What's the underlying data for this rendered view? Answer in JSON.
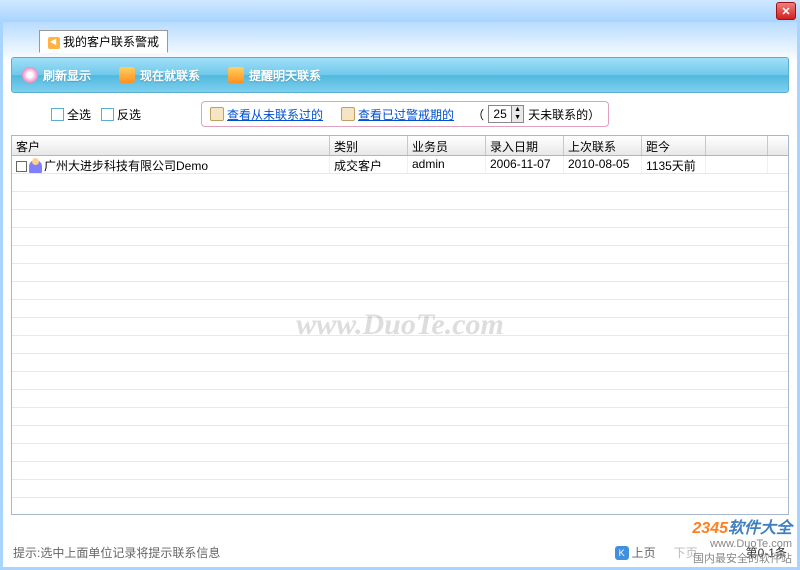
{
  "tab": {
    "label": "我的客户联系警戒"
  },
  "toolbar": {
    "refresh": "刷新显示",
    "contact_now": "现在就联系",
    "remind_tomorrow": "提醒明天联系"
  },
  "filters": {
    "select_all": "全选",
    "invert": "反选",
    "view_never": "查看从未联系过的",
    "view_expired": "查看已过警戒期的",
    "days_value": "25",
    "days_suffix": "天未联系的）",
    "days_prefix": "（"
  },
  "grid": {
    "headers": {
      "customer": "客户",
      "category": "类别",
      "salesperson": "业务员",
      "entry_date": "录入日期",
      "last_contact": "上次联系",
      "since": "距今"
    },
    "rows": [
      {
        "customer": "广州大进步科技有限公司Demo",
        "category": "成交客户",
        "salesperson": "admin",
        "entry_date": "2006-11-07",
        "last_contact": "2010-08-05",
        "since": "1135天前"
      }
    ]
  },
  "watermark": "www.DuoTe.com",
  "footer": {
    "hint": "提示:选中上面单位记录将提示联系信息",
    "prev": "上页",
    "next": "下页",
    "page_info": "第0-1条"
  },
  "branding": {
    "name_prefix": "2345",
    "name_suffix": "软件大全",
    "site": "www.DuoTe.com",
    "slogan": "国内最安全的软件站"
  }
}
